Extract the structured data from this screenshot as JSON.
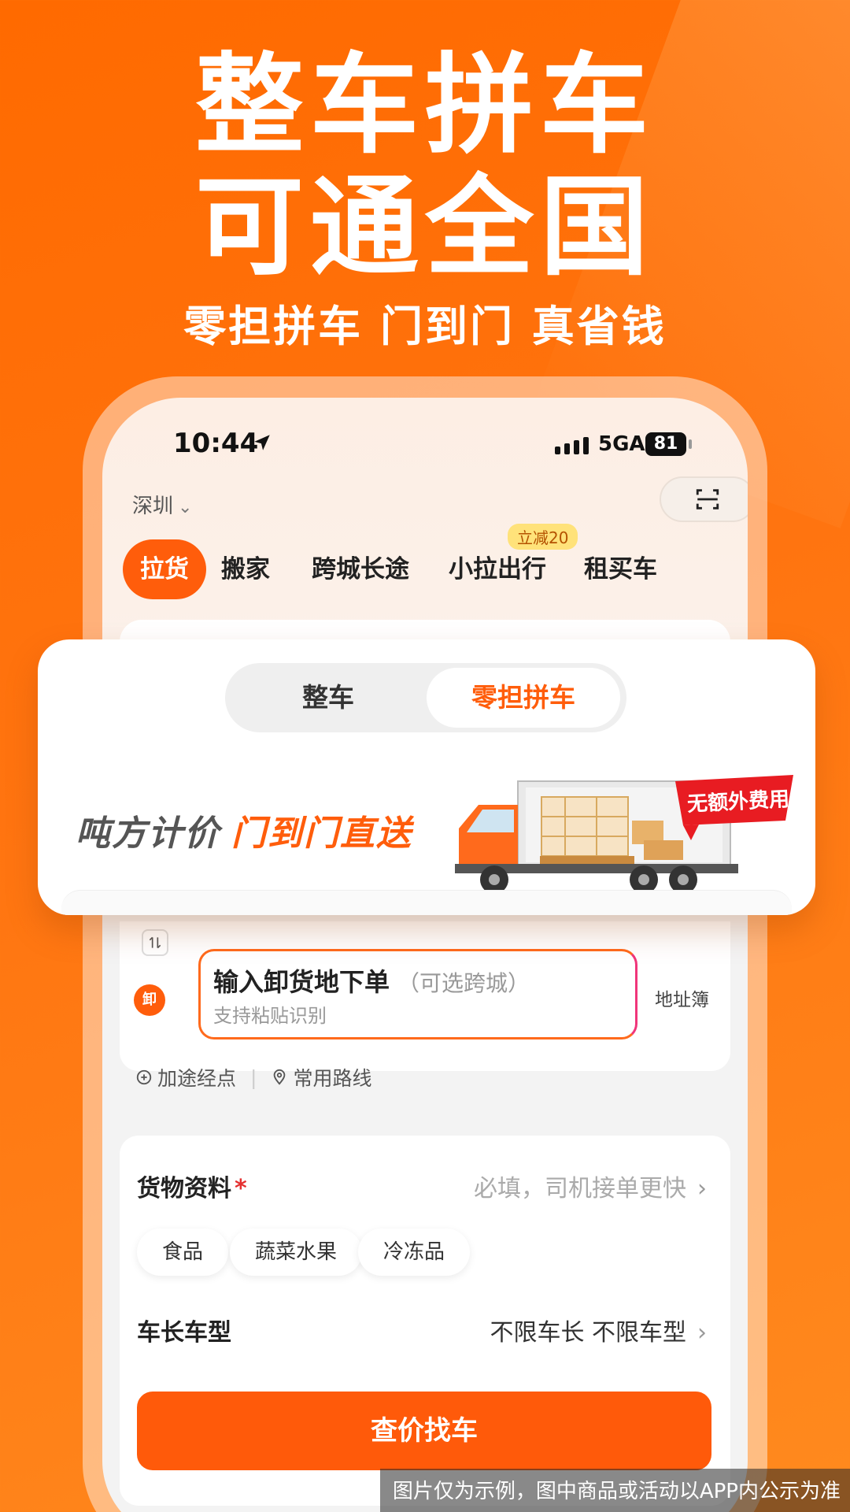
{
  "hero": {
    "title_line1": "整车拼车",
    "title_line2": "可通全国",
    "subtitle": "零担拼车 门到门 真省钱"
  },
  "status_bar": {
    "time": "10:44",
    "network": "5GA",
    "battery": "81"
  },
  "header": {
    "city": "深圳"
  },
  "tabs": [
    {
      "label": "拉货",
      "active": true
    },
    {
      "label": "搬家"
    },
    {
      "label": "跨城长途"
    },
    {
      "label": "小拉出行",
      "badge": "立减20"
    },
    {
      "label": "租买车"
    }
  ],
  "segment": {
    "option1": "整车",
    "option2": "零担拼车",
    "selected": "零担拼车"
  },
  "banner": {
    "slogan_part1": "吨方计价",
    "slogan_part2": "门到门直送",
    "tag": "无额外费用"
  },
  "address": {
    "unload_marker": "卸",
    "input_main": "输入卸货地下单",
    "input_optional": "（可选跨城）",
    "input_hint": "支持粘贴识别",
    "address_book": "地址簿",
    "add_stop": "加途经点",
    "common_routes": "常用路线"
  },
  "cargo": {
    "label": "货物资料",
    "required_mark": "*",
    "placeholder": "必填，司机接单更快",
    "chips": [
      "食品",
      "蔬菜水果",
      "冷冻品"
    ],
    "vehicle_label": "车长车型",
    "vehicle_value": "不限车长 不限车型",
    "cta": "查价找车"
  },
  "disclaimer": "图片仅为示例，图中商品或活动以APP内公示为准",
  "colors": {
    "brand_orange": "#ff5d0b",
    "accent_pink": "#f0357a",
    "badge_yellow": "#ffe27a"
  }
}
